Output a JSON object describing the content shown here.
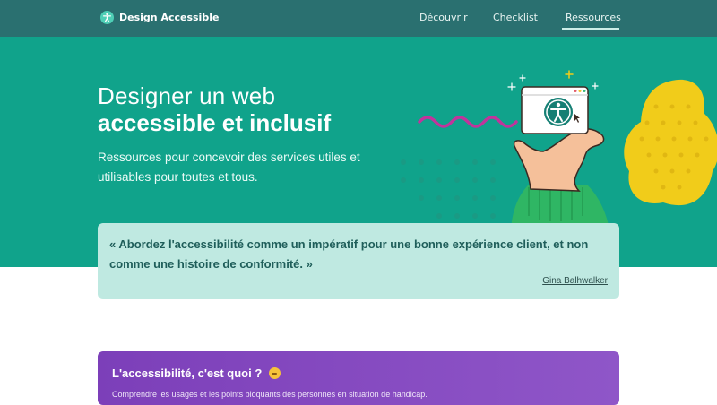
{
  "header": {
    "site_name": "Design Accessible",
    "nav": [
      {
        "label": "Découvrir"
      },
      {
        "label": "Checklist"
      },
      {
        "label": "Ressources",
        "active": true
      }
    ]
  },
  "hero": {
    "title_line1": "Designer un web",
    "title_line2": "accessible et inclusif",
    "subtitle": "Ressources pour concevoir des services utiles et utilisables pour toutes et tous."
  },
  "quote": {
    "text": "« Abordez l'accessibilité comme un impératif pour une bonne expérience client, et non comme une histoire de conformité. »",
    "author": "Gina Balhwalker"
  },
  "info": {
    "title": "L'accessibilité, c'est quoi ?",
    "emoji": "thinking-face-icon",
    "text": "Comprendre les usages et les points bloquants des personnes en situation de handicap."
  },
  "colors": {
    "topbar": "#2a7070",
    "hero": "#10a38b",
    "quote_bg": "#bfe9e1",
    "info_bg": "#8448bf",
    "accent_yellow": "#f1cc1a",
    "accent_pink": "#c1349c"
  }
}
